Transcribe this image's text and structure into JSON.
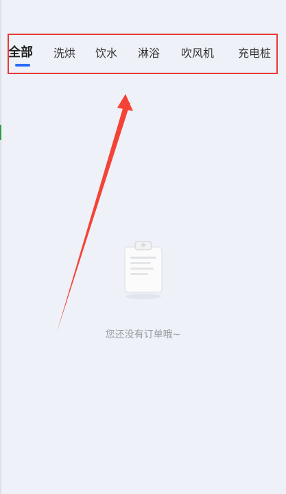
{
  "tabs": [
    {
      "label": "全部",
      "active": true
    },
    {
      "label": "洗烘",
      "active": false
    },
    {
      "label": "饮水",
      "active": false
    },
    {
      "label": "淋浴",
      "active": false
    },
    {
      "label": "吹风机",
      "active": false
    },
    {
      "label": "充电桩",
      "active": false
    }
  ],
  "empty_state": {
    "icon": "clipboard-icon",
    "message": "您还没有订单哦~"
  },
  "colors": {
    "background": "#eef1f7",
    "active_indicator": "#2b6cf6",
    "annotation_red": "#e53935",
    "muted_text": "#9a9ca3"
  }
}
